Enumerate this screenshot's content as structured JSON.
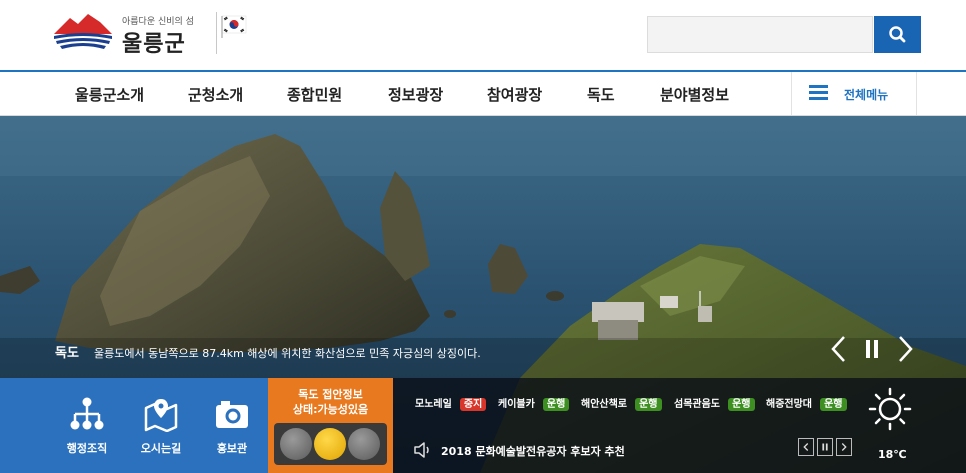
{
  "header": {
    "slogan": "아름다운 신비의 섬",
    "site_name": "울릉군",
    "search": {
      "placeholder": ""
    }
  },
  "nav": {
    "items": [
      {
        "label": "울릉군소개"
      },
      {
        "label": "군청소개"
      },
      {
        "label": "종합민원"
      },
      {
        "label": "정보광장"
      },
      {
        "label": "참여광장"
      },
      {
        "label": "독도"
      },
      {
        "label": "분야별정보"
      }
    ],
    "all_menu_label": "전체메뉴"
  },
  "hero": {
    "caption_title": "독도",
    "caption_text": "울릉도에서 동남쪽으로 87.4km 해상에 위치한 화산섬으로 민족 자긍심의 상징이다."
  },
  "quick_links": [
    {
      "label": "행정조직",
      "icon": "org-chart-icon"
    },
    {
      "label": "오시는길",
      "icon": "map-icon"
    },
    {
      "label": "홍보관",
      "icon": "camera-icon"
    }
  ],
  "dokdo_info": {
    "title": "독도 접안정보",
    "status": "상태:가능성있음"
  },
  "transport": [
    {
      "name": "모노레일",
      "status": "중지",
      "color": "#d9362b"
    },
    {
      "name": "케이블카",
      "status": "운행",
      "color": "#3d8f22"
    },
    {
      "name": "해안산책로",
      "status": "운행",
      "color": "#3d8f22"
    },
    {
      "name": "섬목관음도",
      "status": "운행",
      "color": "#3d8f22"
    },
    {
      "name": "해중전망대",
      "status": "운행",
      "color": "#3d8f22"
    }
  ],
  "notice": {
    "text": "2018 문화예술발전유공자 후보자 추천"
  },
  "weather": {
    "temp": "18℃",
    "icon": "sun-icon"
  },
  "colors": {
    "brand_blue": "#1f74c2",
    "quick_bg": "#2b71bd",
    "dokdo_bg": "#e8791f",
    "status_stop": "#d9362b",
    "status_run": "#3d8f22"
  }
}
